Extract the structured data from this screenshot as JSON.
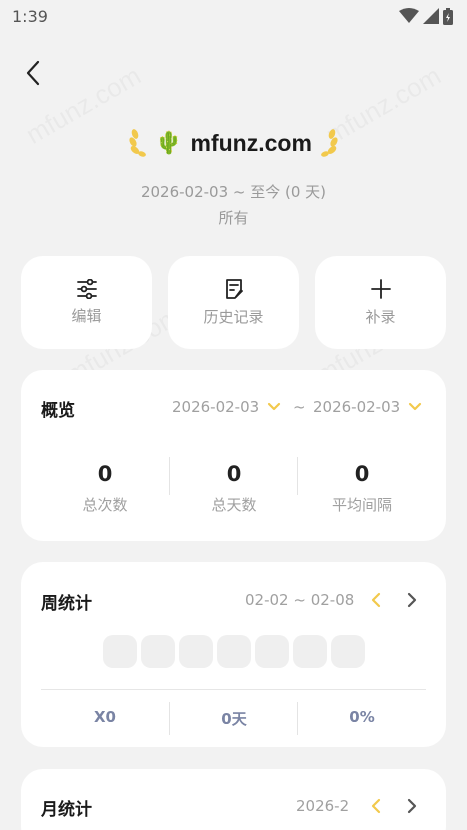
{
  "status_bar": {
    "time": "1:39"
  },
  "header": {
    "emoji": "🌵",
    "title": "mfunz.com"
  },
  "period": {
    "range": "2026-02-03 ~ 至今 (0 天)",
    "scope": "所有"
  },
  "actions": [
    {
      "label": "编辑",
      "icon": "sliders-icon"
    },
    {
      "label": "历史记录",
      "icon": "history-note-icon"
    },
    {
      "label": "补录",
      "icon": "plus-icon"
    }
  ],
  "overview": {
    "title": "概览",
    "start_date": "2026-02-03",
    "separator": "~",
    "end_date": "2026-02-03",
    "stats": [
      {
        "value": "0",
        "label": "总次数"
      },
      {
        "value": "0",
        "label": "总天数"
      },
      {
        "value": "0",
        "label": "平均间隔"
      }
    ]
  },
  "weekly": {
    "title": "周统计",
    "range": "02-02 ~ 02-08",
    "stats": [
      "X0",
      "0天",
      "0%"
    ]
  },
  "monthly": {
    "title": "月统计",
    "month": "2026-2"
  },
  "colors": {
    "accent": "#f2c94c",
    "background": "#f2f2f2",
    "card": "#ffffff"
  }
}
